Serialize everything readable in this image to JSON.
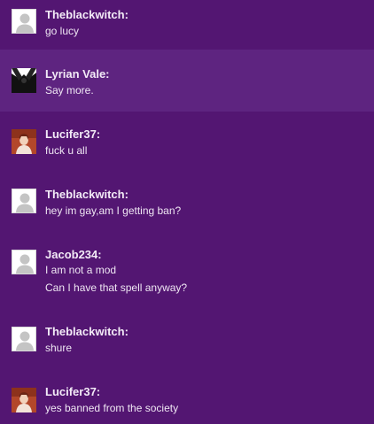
{
  "messages": [
    {
      "author": "Theblackwitch:",
      "avatar": "default-user-icon",
      "lines": [
        "go lucy"
      ]
    },
    {
      "author": "Lyrian Vale:",
      "avatar": "dark-figure-avatar",
      "lines": [
        "Say more."
      ],
      "highlighted": true
    },
    {
      "author": "Lucifer37:",
      "avatar": "red-portrait-avatar",
      "lines": [
        "fuck u all"
      ]
    },
    {
      "author": "Theblackwitch:",
      "avatar": "default-user-icon",
      "lines": [
        "hey im gay,am I getting ban?"
      ]
    },
    {
      "author": "Jacob234:",
      "avatar": "default-user-icon",
      "lines": [
        "I am not a mod",
        "Can I have that spell anyway?"
      ]
    },
    {
      "author": "Theblackwitch:",
      "avatar": "default-user-icon",
      "lines": [
        "shure"
      ]
    },
    {
      "author": "Lucifer37:",
      "avatar": "red-portrait-avatar",
      "lines": [
        "yes banned from the society"
      ]
    }
  ],
  "colors": {
    "background": "#531672",
    "highlight": "#5e2480",
    "text": "#efe6f3"
  }
}
